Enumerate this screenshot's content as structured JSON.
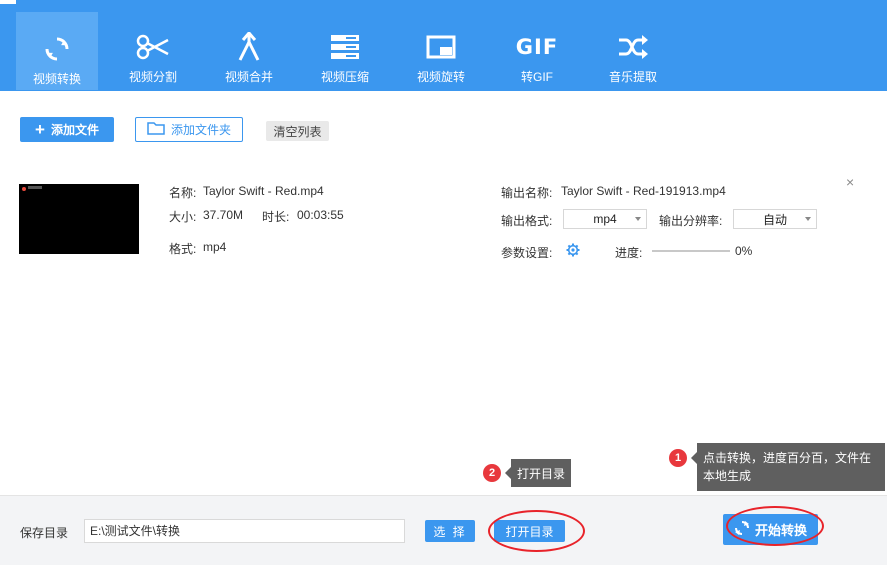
{
  "nav": [
    {
      "label": "视频转换",
      "icon": "refresh-icon",
      "active": true
    },
    {
      "label": "视频分割",
      "icon": "scissors-icon",
      "active": false
    },
    {
      "label": "视频合并",
      "icon": "merge-icon",
      "active": false
    },
    {
      "label": "视频压缩",
      "icon": "compress-icon",
      "active": false
    },
    {
      "label": "视频旋转",
      "icon": "rotate-icon",
      "active": false
    },
    {
      "label": "转GIF",
      "icon": "gif-icon",
      "active": false
    },
    {
      "label": "音乐提取",
      "icon": "shuffle-icon",
      "active": false
    }
  ],
  "gif_icon_text": "GIF",
  "actions": {
    "add_file": "添加文件",
    "add_folder": "添加文件夹",
    "clear_list": "清空列表"
  },
  "file": {
    "name_label": "名称:",
    "name_value": "Taylor Swift - Red.mp4",
    "size_label": "大小:",
    "size_value": "37.70M",
    "duration_label": "时长:",
    "duration_value": "00:03:55",
    "format_label": "格式:",
    "format_value": "mp4",
    "output_name_label": "输出名称:",
    "output_name_value": "Taylor Swift - Red-191913.mp4",
    "output_format_label": "输出格式:",
    "output_format_value": "mp4",
    "output_resolution_label": "输出分辨率:",
    "output_resolution_value": "自动",
    "params_label": "参数设置:",
    "progress_label": "进度:",
    "progress_text": "0%",
    "progress_value": 0,
    "close": "×"
  },
  "bottom": {
    "save_label": "保存目录",
    "save_path": "E:\\测试文件\\转换",
    "select_button": "选 择",
    "open_button": "打开目录",
    "start_button": "开始转换"
  },
  "tips": {
    "tip1_badge": "1",
    "tip1_line1": "点击转换，进度百分百，文件在",
    "tip1_line2": "本地生成",
    "tip2_badge": "2",
    "tip2_text": "打开目录"
  },
  "colors": {
    "primary": "#3b97ef",
    "active_tab": "#5aaaf4",
    "highlight_ring": "#e8232a",
    "tooltip": "#5f5f5f",
    "badge": "#e8383d"
  }
}
